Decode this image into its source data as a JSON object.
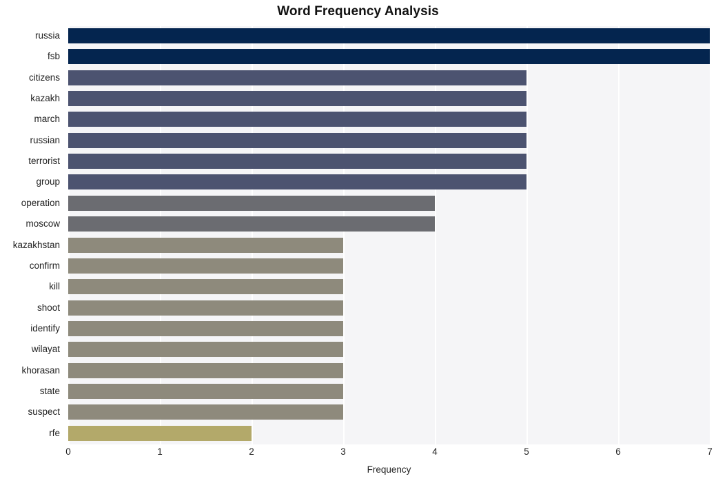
{
  "chart_data": {
    "type": "bar",
    "orientation": "horizontal",
    "title": "Word Frequency Analysis",
    "xlabel": "Frequency",
    "ylabel": "",
    "xlim": [
      0,
      7.0
    ],
    "ylim": [
      0,
      20
    ],
    "grid": true,
    "legend": "none",
    "xticks": [
      "0",
      "1",
      "2",
      "3",
      "4",
      "5",
      "6",
      "7"
    ],
    "xtick_values": [
      0,
      1,
      2,
      3,
      4,
      5,
      6,
      7
    ],
    "categories": [
      "russia",
      "fsb",
      "citizens",
      "kazakh",
      "march",
      "russian",
      "terrorist",
      "group",
      "operation",
      "moscow",
      "kazakhstan",
      "confirm",
      "kill",
      "shoot",
      "identify",
      "wilayat",
      "khorasan",
      "state",
      "suspect",
      "rfe"
    ],
    "values": [
      7,
      7,
      5,
      5,
      5,
      5,
      5,
      5,
      4,
      4,
      3,
      3,
      3,
      3,
      3,
      3,
      3,
      3,
      3,
      2
    ],
    "bar_colors": [
      "#04254f",
      "#04254f",
      "#4c5370",
      "#4c5370",
      "#4c5370",
      "#4c5370",
      "#4c5370",
      "#4c5370",
      "#6b6c71",
      "#6b6c71",
      "#8e8a7c",
      "#8e8a7c",
      "#8e8a7c",
      "#8e8a7c",
      "#8e8a7c",
      "#8e8a7c",
      "#8e8a7c",
      "#8e8a7c",
      "#8e8a7c",
      "#b3a96a"
    ]
  },
  "style": {
    "figure_background": "#ffffff",
    "plot_background": "#f5f5f7",
    "gridline_color": "#ffffff",
    "title_color": "#111111",
    "tick_label_color": "#222222"
  }
}
